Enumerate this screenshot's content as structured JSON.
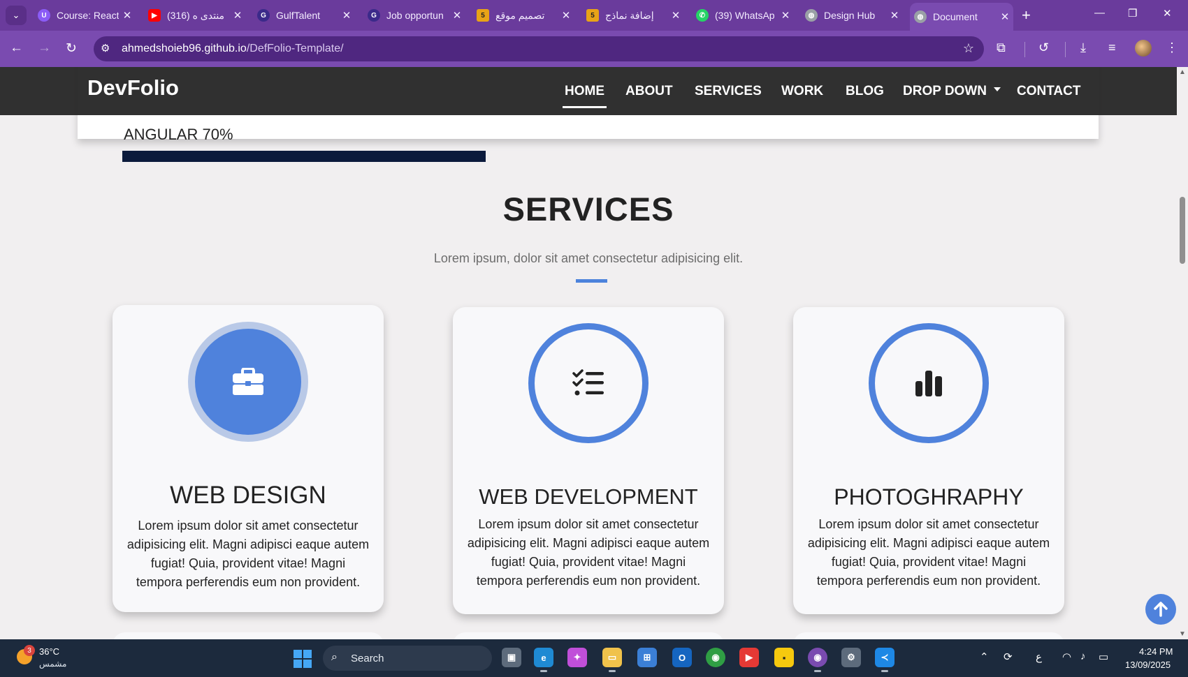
{
  "browser": {
    "tabs": [
      {
        "title": "Course: React",
        "favicon_color": "#8b5cf6",
        "favicon_glyph": "U"
      },
      {
        "title": "(316) منتدى ه",
        "favicon_color": "#ff0000",
        "favicon_glyph": "▶"
      },
      {
        "title": "GulfTalent",
        "favicon_color": "#3b2a8a",
        "favicon_glyph": "G"
      },
      {
        "title": "Job opportun",
        "favicon_color": "#3b2a8a",
        "favicon_glyph": "G"
      },
      {
        "title": "تصميم موقع",
        "favicon_color": "#e8a317",
        "favicon_glyph": "5"
      },
      {
        "title": "إضافة نماذج",
        "favicon_color": "#e8a317",
        "favicon_glyph": "5"
      },
      {
        "title": "(39) WhatsAp",
        "favicon_color": "#25d366",
        "favicon_glyph": "✆"
      },
      {
        "title": "Design Hub",
        "favicon_color": "#9aa0a6",
        "favicon_glyph": "◍"
      },
      {
        "title": "Document",
        "favicon_color": "#9aa0a6",
        "favicon_glyph": "◍"
      }
    ],
    "active_tab": 8,
    "url_host": "ahmedshoieb96.github.io",
    "url_path": "/DefFolio-Template/",
    "theme_color": "#7a4bb0"
  },
  "site": {
    "brand": "DevFolio",
    "nav": [
      "HOME",
      "ABOUT",
      "SERVICES",
      "WORK",
      "BLOG",
      "DROP DOWN",
      "CONTACT"
    ],
    "active_nav": "HOME",
    "skill_peek": {
      "label": "ANGULAR 70%",
      "percent": 70
    }
  },
  "services": {
    "title": "SERVICES",
    "subtitle": "Lorem ipsum, dolor sit amet consectetur adipisicing elit.",
    "accent_color": "#4f82dc",
    "cards": [
      {
        "title": "WEB DESIGN",
        "icon": "briefcase-icon",
        "text": "Lorem ipsum dolor sit amet consectetur adipisicing elit. Magni adipisci eaque autem fugiat! Quia, provident vitae! Magni tempora perferendis eum non provident."
      },
      {
        "title": "WEB DEVELOPMENT",
        "icon": "checklist-icon",
        "text": "Lorem ipsum dolor sit amet consectetur adipisicing elit. Magni adipisci eaque autem fugiat! Quia, provident vitae! Magni tempora perferendis eum non provident."
      },
      {
        "title": "PHOTOGHRAPHY",
        "icon": "bar-chart-icon",
        "text": "Lorem ipsum dolor sit amet consectetur adipisicing elit. Magni adipisci eaque autem fugiat! Quia, provident vitae! Magni tempora perferendis eum non provident."
      }
    ]
  },
  "taskbar": {
    "weather_temp": "36°C",
    "weather_desc": "مشمس",
    "weather_badge": "3",
    "search_label": "Search",
    "time": "4:24 PM",
    "date": "13/09/2025",
    "lang": "ع"
  }
}
